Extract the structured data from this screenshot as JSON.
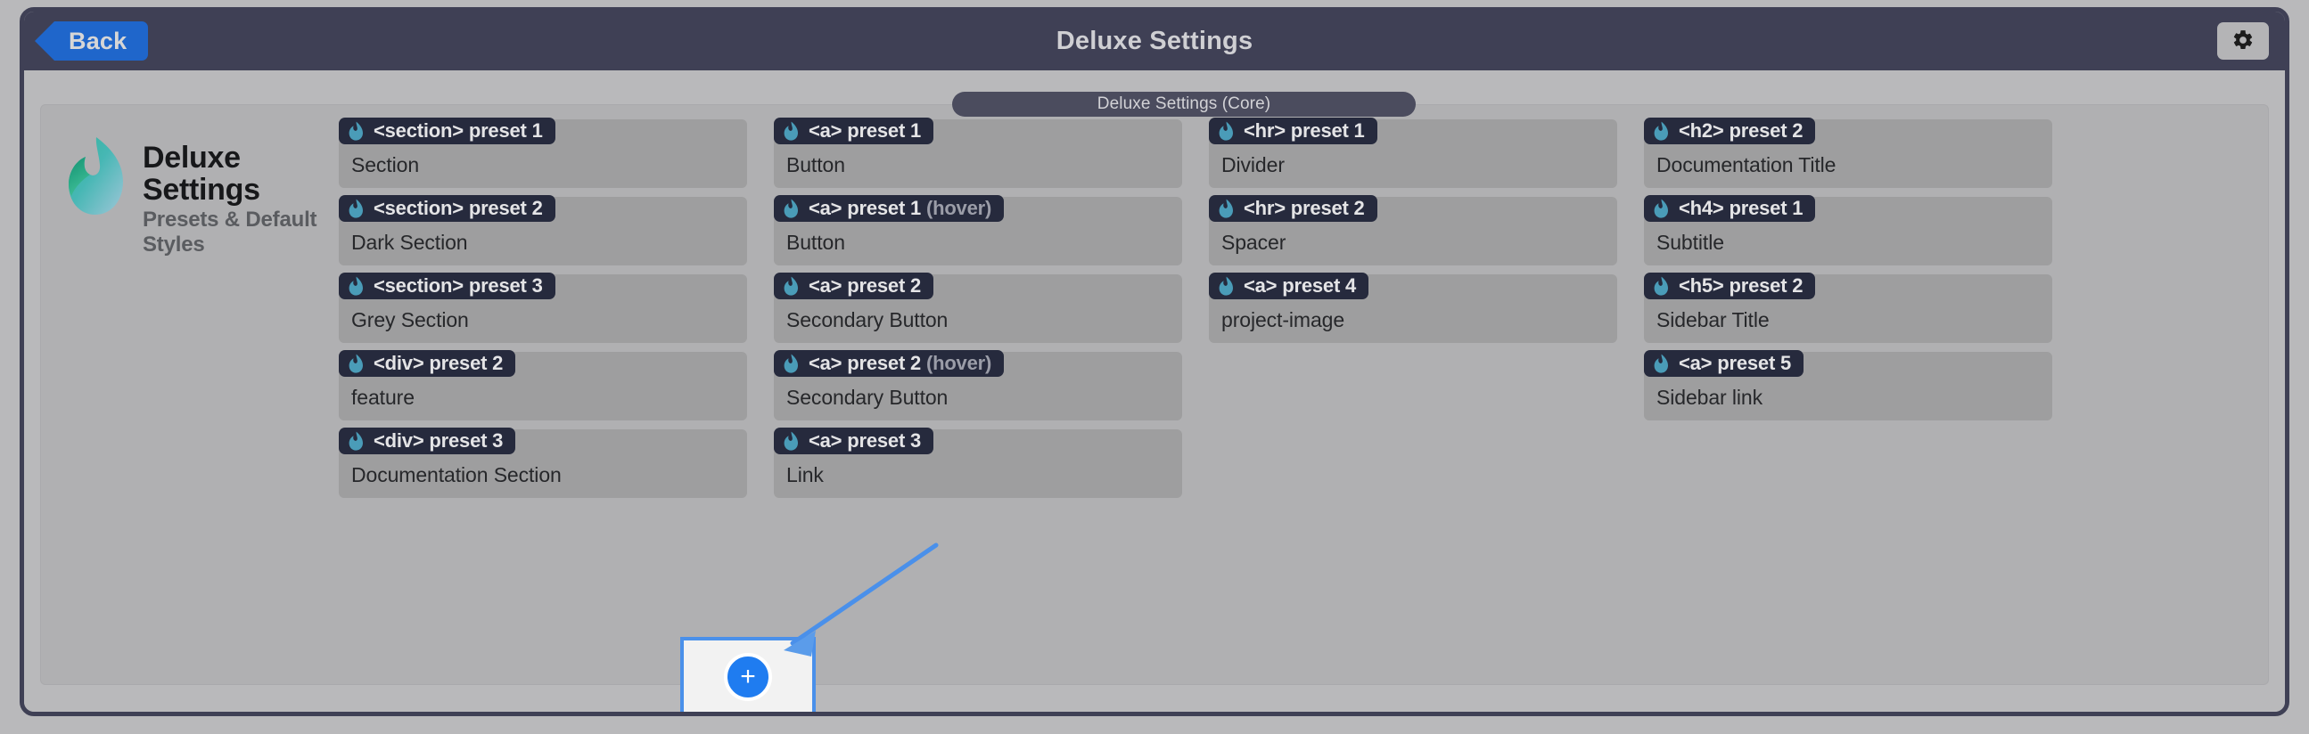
{
  "window": {
    "header": {
      "back_label": "Back",
      "title": "Deluxe Settings",
      "gear_icon": "gear-icon"
    },
    "accent_blue": "#1f7cf0",
    "header_bg": "#3f4055",
    "badge_bg": "#262a3d",
    "droplet_color": "#4a9cb8",
    "card_bg": "#9e9e9f",
    "panel_bg": "#b0b0b2"
  },
  "tab": {
    "label": "Deluxe Settings (Core)"
  },
  "brand": {
    "title": "Deluxe Settings",
    "subtitle": "Presets & Default Styles",
    "logo_icon": "droplet-logo-icon"
  },
  "columns": [
    {
      "name": "column-1",
      "cards": [
        {
          "badge": "<section> preset 1",
          "badge_suffix": "",
          "label": "Section"
        },
        {
          "badge": "<section> preset 2",
          "badge_suffix": "",
          "label": "Dark Section"
        },
        {
          "badge": "<section> preset 3",
          "badge_suffix": "",
          "label": "Grey Section"
        },
        {
          "badge": "<div> preset 2",
          "badge_suffix": "",
          "label": "feature"
        },
        {
          "badge": "<div> preset 3",
          "badge_suffix": "",
          "label": "Documentation Section"
        }
      ]
    },
    {
      "name": "column-2",
      "cards": [
        {
          "badge": "<a> preset 1",
          "badge_suffix": "",
          "label": "Button"
        },
        {
          "badge": "<a> preset 1",
          "badge_suffix": "(hover)",
          "label": "Button"
        },
        {
          "badge": "<a> preset 2",
          "badge_suffix": "",
          "label": "Secondary Button"
        },
        {
          "badge": "<a> preset 2",
          "badge_suffix": "(hover)",
          "label": "Secondary Button"
        },
        {
          "badge": "<a> preset 3",
          "badge_suffix": "",
          "label": "Link"
        }
      ]
    },
    {
      "name": "column-3",
      "cards": [
        {
          "badge": "<hr> preset 1",
          "badge_suffix": "",
          "label": "Divider"
        },
        {
          "badge": "<hr> preset 2",
          "badge_suffix": "",
          "label": "Spacer"
        },
        {
          "badge": "<a> preset 4",
          "badge_suffix": "",
          "label": "project-image"
        }
      ]
    },
    {
      "name": "column-4",
      "cards": [
        {
          "badge": "<h2> preset 2",
          "badge_suffix": "",
          "label": "Documentation Title"
        },
        {
          "badge": "<h4> preset 1",
          "badge_suffix": "",
          "label": "Subtitle"
        },
        {
          "badge": "<h5> preset 2",
          "badge_suffix": "",
          "label": "Sidebar Title"
        },
        {
          "badge": "<a> preset 5",
          "badge_suffix": "",
          "label": "Sidebar link"
        }
      ]
    }
  ],
  "add_preset": {
    "label": "+",
    "icon": "plus-icon"
  }
}
